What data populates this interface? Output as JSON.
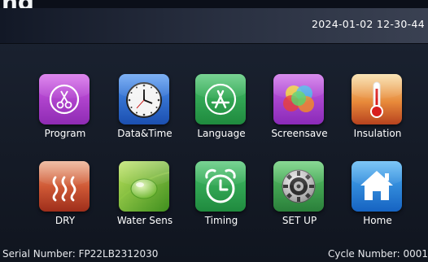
{
  "corner_text": "ng",
  "header": {
    "datetime": "2024-01-02 12-30-44"
  },
  "tiles": [
    {
      "label": "Program",
      "icon": "scissors-icon",
      "color": "#b43fcf"
    },
    {
      "label": "Data&Time",
      "icon": "clock-icon",
      "color": "#2a6fd6"
    },
    {
      "label": "Language",
      "icon": "app-store-icon",
      "color": "#2fa24f"
    },
    {
      "label": "Screensave",
      "icon": "color-circles-icon",
      "color": "#a73bd0"
    },
    {
      "label": "Insulation",
      "icon": "thermometer-icon",
      "color": "#d9722c"
    },
    {
      "label": "DRY",
      "icon": "heat-waves-icon",
      "color": "#c2452a"
    },
    {
      "label": "Water Sens",
      "icon": "water-drop-leaf-icon",
      "color": "#5aa92d"
    },
    {
      "label": "Timing",
      "icon": "alarm-clock-icon",
      "color": "#2fa24f"
    },
    {
      "label": "SET UP",
      "icon": "gear-icon",
      "color": "#3c9a4a"
    },
    {
      "label": "Home",
      "icon": "home-icon",
      "color": "#1f86d8"
    }
  ],
  "footer": {
    "serial": "Serial Number: FP22LB2312030",
    "cycle": "Cycle Number: 0001"
  }
}
